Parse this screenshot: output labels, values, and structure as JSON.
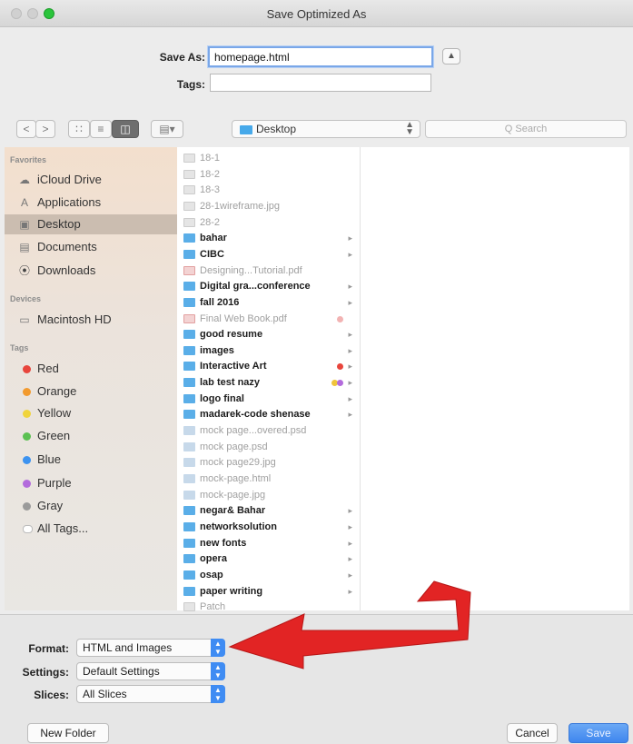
{
  "window": {
    "title": "Save Optimized As"
  },
  "save": {
    "save_as_label": "Save As:",
    "filename": "homepage.html",
    "tags_label": "Tags:",
    "tags_value": "",
    "disclosure_icon": "chevron-up-icon"
  },
  "toolbar": {
    "back": "<",
    "forward": ">",
    "location": "Desktop",
    "search_placeholder": "Q Search"
  },
  "sidebar": {
    "favorites_header": "Favorites",
    "favorites": [
      {
        "label": "iCloud Drive",
        "icon": "cloud-icon"
      },
      {
        "label": "Applications",
        "icon": "applications-icon"
      },
      {
        "label": "Desktop",
        "icon": "desktop-icon",
        "selected": true
      },
      {
        "label": "Documents",
        "icon": "documents-icon"
      },
      {
        "label": "Downloads",
        "icon": "downloads-icon"
      }
    ],
    "devices_header": "Devices",
    "devices": [
      {
        "label": "Macintosh HD",
        "icon": "hard-drive-icon"
      }
    ],
    "tags_header": "Tags",
    "tags": [
      {
        "label": "Red",
        "color": "#e8453c"
      },
      {
        "label": "Orange",
        "color": "#f29a2e"
      },
      {
        "label": "Yellow",
        "color": "#f0d43c"
      },
      {
        "label": "Green",
        "color": "#5cc152"
      },
      {
        "label": "Blue",
        "color": "#3d93f0"
      },
      {
        "label": "Purple",
        "color": "#b36bdc"
      },
      {
        "label": "Gray",
        "color": "#9b9b9b"
      }
    ],
    "all_tags": "All Tags..."
  },
  "files": [
    {
      "name": "18-1",
      "kind": "doc",
      "dim": true
    },
    {
      "name": "18-2",
      "kind": "doc",
      "dim": true
    },
    {
      "name": "18-3",
      "kind": "doc",
      "dim": true
    },
    {
      "name": "28-1wireframe.jpg",
      "kind": "doc",
      "dim": true
    },
    {
      "name": "28-2",
      "kind": "doc",
      "dim": true
    },
    {
      "name": "bahar",
      "kind": "folder",
      "chevron": true
    },
    {
      "name": "CIBC",
      "kind": "folder",
      "chevron": true
    },
    {
      "name": "Designing...Tutorial.pdf",
      "kind": "pdf",
      "dim": true
    },
    {
      "name": "Digital gra...conference",
      "kind": "folder",
      "chevron": true
    },
    {
      "name": "fall 2016",
      "kind": "folder",
      "chevron": true
    },
    {
      "name": "Final Web Book.pdf",
      "kind": "pdf",
      "dim": true,
      "tag": "#f2b3b3"
    },
    {
      "name": "good resume",
      "kind": "folder",
      "chevron": true
    },
    {
      "name": "images",
      "kind": "folder",
      "chevron": true
    },
    {
      "name": "Interactive Art",
      "kind": "folder",
      "chevron": true,
      "tag": "#e8453c"
    },
    {
      "name": "lab test nazy",
      "kind": "folder",
      "chevron": true,
      "tag": "#f0c43c",
      "tag2": "#b36bdc"
    },
    {
      "name": "logo final",
      "kind": "folder",
      "chevron": true
    },
    {
      "name": "madarek-code shenase",
      "kind": "folder",
      "chevron": true
    },
    {
      "name": "mock page...overed.psd",
      "kind": "image",
      "dim": true
    },
    {
      "name": "mock page.psd",
      "kind": "image",
      "dim": true
    },
    {
      "name": "mock page29.jpg",
      "kind": "image",
      "dim": true
    },
    {
      "name": "mock-page.html",
      "kind": "image",
      "dim": true
    },
    {
      "name": "mock-page.jpg",
      "kind": "image",
      "dim": true
    },
    {
      "name": "negar& Bahar",
      "kind": "folder",
      "chevron": true
    },
    {
      "name": "networksolution",
      "kind": "folder",
      "chevron": true
    },
    {
      "name": "new fonts",
      "kind": "folder",
      "chevron": true
    },
    {
      "name": "opera",
      "kind": "folder",
      "chevron": true
    },
    {
      "name": "osap",
      "kind": "folder",
      "chevron": true
    },
    {
      "name": "paper writing",
      "kind": "folder",
      "chevron": true
    },
    {
      "name": "Patch",
      "kind": "doc",
      "dim": true
    }
  ],
  "options": {
    "format_label": "Format:",
    "format_value": "HTML and Images",
    "settings_label": "Settings:",
    "settings_value": "Default Settings",
    "slices_label": "Slices:",
    "slices_value": "All Slices"
  },
  "buttons": {
    "new_folder": "New Folder",
    "cancel": "Cancel",
    "save": "Save"
  },
  "colors": {
    "accent": "#3f86ee",
    "annotation_arrow": "#e22424"
  }
}
